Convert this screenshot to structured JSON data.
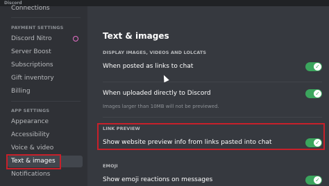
{
  "titlebar": {
    "title": "Discord"
  },
  "sidebar": {
    "top_item": "Connections",
    "payment_header": "PAYMENT SETTINGS",
    "payment_items": [
      "Discord Nitro",
      "Server Boost",
      "Subscriptions",
      "Gift inventory",
      "Billing"
    ],
    "app_header": "APP SETTINGS",
    "app_items": [
      "Appearance",
      "Accessibility",
      "Voice & video",
      "Text & images",
      "Notifications"
    ]
  },
  "main": {
    "title": "Text & images",
    "section1": "DISPLAY IMAGES, VIDEOS AND LOLCATS",
    "opt1": "When posted as links to chat",
    "opt2": "When uploaded directly to Discord",
    "opt2_note": "Images larger than 10MB will not be previewed.",
    "section2": "LINK PREVIEW",
    "opt3": "Show website preview info from links pasted into chat",
    "section3": "EMOJI",
    "opt4": "Show emoji reactions on messages"
  },
  "colors": {
    "accent_green": "#3ba55d",
    "highlight_red": "#c8202a"
  },
  "icons": {
    "toggle_on": "check-icon",
    "nitro": "nitro-icon",
    "cursor": "mouse-cursor-icon"
  },
  "toggles": {
    "opt1": true,
    "opt2": true,
    "opt3": true,
    "opt4": true
  }
}
